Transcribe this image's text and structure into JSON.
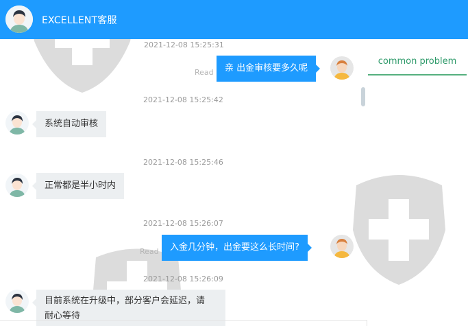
{
  "header": {
    "title": "EXCELLENT客服"
  },
  "right_panel": {
    "tab_label": "common problem"
  },
  "messages": [
    {
      "timestamp": "2021-12-08 15:25:31",
      "side": "right",
      "text": "亲 出金审核要多久呢",
      "status": "Read"
    },
    {
      "timestamp": "2021-12-08 15:25:42",
      "side": "left",
      "text": "系统自动审核"
    },
    {
      "timestamp": "2021-12-08 15:25:46",
      "side": "left",
      "text": "正常都是半小时内"
    },
    {
      "timestamp": "2021-12-08 15:26:07",
      "side": "right",
      "text": "入金几分钟，出金要这么长时间?",
      "status": "Read"
    },
    {
      "timestamp": "2021-12-08 15:26:09",
      "side": "left",
      "text_line1": "目前系统在升级中，部分客户会延迟，请",
      "text_line2": "耐心等待"
    }
  ],
  "colors": {
    "brand_blue": "#1e9bff",
    "bubble_grey": "#eceff1",
    "tab_green": "#55b07e"
  },
  "icons": {
    "header_avatar": "agent-avatar-icon",
    "user_avatar": "user-avatar-icon",
    "agent_avatar": "agent-avatar-icon",
    "watermark": "shield-cross-icon"
  }
}
